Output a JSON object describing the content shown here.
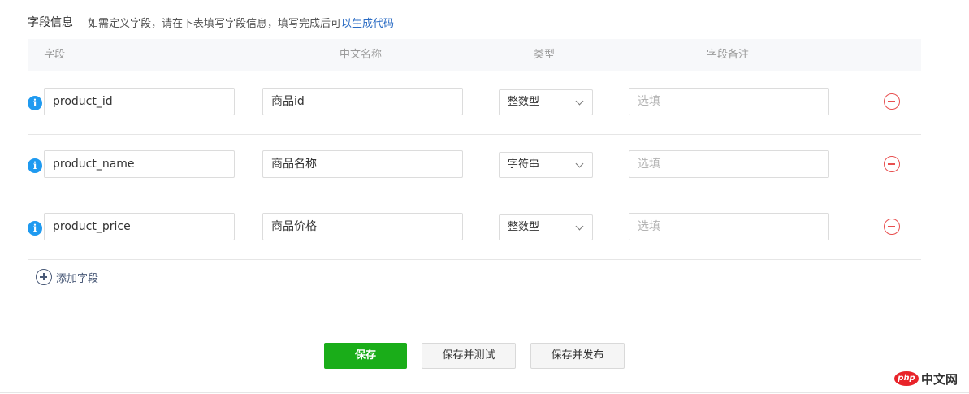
{
  "header": {
    "title": "字段信息",
    "description": "如需定义字段，请在下表填写字段信息，填写完成后可",
    "link_text": "以生成代码"
  },
  "table": {
    "columns": {
      "field": "字段",
      "cn_name": "中文名称",
      "type": "类型",
      "remark": "字段备注"
    },
    "rows": [
      {
        "field": "product_id",
        "cn_name": "商品id",
        "type": "整数型",
        "remark_placeholder": "选填"
      },
      {
        "field": "product_name",
        "cn_name": "商品名称",
        "type": "字符串",
        "remark_placeholder": "选填"
      },
      {
        "field": "product_price",
        "cn_name": "商品价格",
        "type": "整数型",
        "remark_placeholder": "选填"
      }
    ]
  },
  "add_field_label": "添加字段",
  "buttons": {
    "save": "保存",
    "save_test": "保存并测试",
    "save_publish": "保存并发布"
  },
  "watermark": {
    "badge": "php",
    "text": "中文网"
  },
  "colors": {
    "primary_green": "#1aad19",
    "info_blue": "#1f9af0",
    "remove_red": "#e84f4f",
    "link_blue": "#2b6cc4"
  }
}
